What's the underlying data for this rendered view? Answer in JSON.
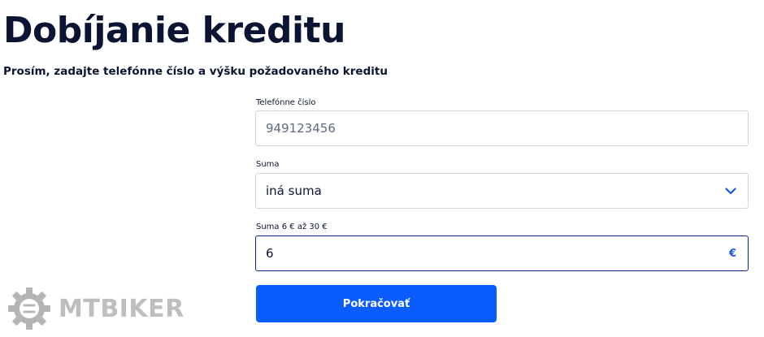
{
  "page": {
    "title": "Dobíjanie kreditu",
    "subtitle": "Prosím, zadajte telefónne číslo a výšku požadovaného kreditu"
  },
  "form": {
    "phone": {
      "label": "Telefónne číslo",
      "value": "949123456"
    },
    "amount_select": {
      "label": "Suma",
      "selected": "iná suma",
      "icon": "chevron-down-icon"
    },
    "custom_amount": {
      "label": "Suma 6 € až 30 €",
      "value": "6",
      "unit": "€"
    },
    "continue_label": "Pokračovať"
  },
  "watermark": {
    "text": "MTBIKER"
  },
  "colors": {
    "accent": "#0a5cff",
    "title": "#0b1533",
    "border": "#cfd6e0",
    "active_border": "#0b2b8a"
  }
}
